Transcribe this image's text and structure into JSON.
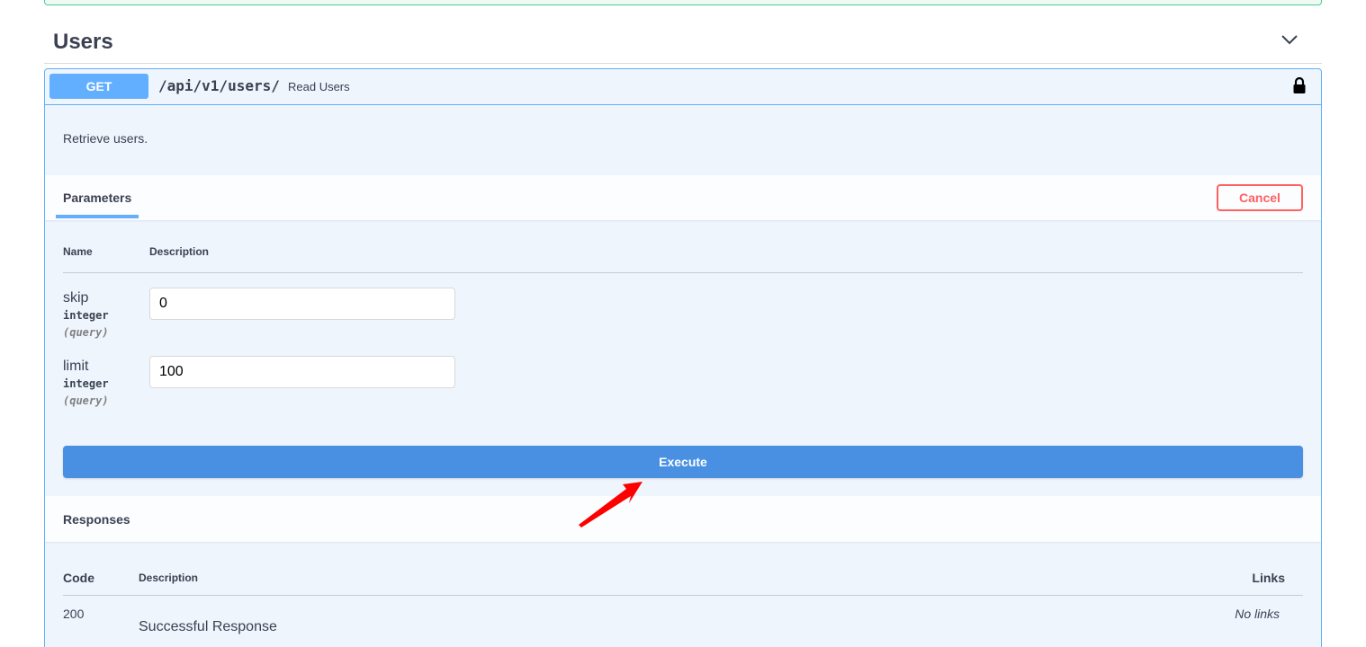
{
  "tag": {
    "title": "Users"
  },
  "operation": {
    "method": "GET",
    "path": "/api/v1/users/",
    "summary": "Read Users",
    "description": "Retrieve users."
  },
  "parameters": {
    "tab_label": "Parameters",
    "cancel_label": "Cancel",
    "col_name": "Name",
    "col_description": "Description",
    "items": [
      {
        "name": "skip",
        "type": "integer",
        "in": "(query)",
        "value": "0"
      },
      {
        "name": "limit",
        "type": "integer",
        "in": "(query)",
        "value": "100"
      }
    ]
  },
  "execute_label": "Execute",
  "responses": {
    "title": "Responses",
    "col_code": "Code",
    "col_description": "Description",
    "col_links": "Links",
    "items": [
      {
        "code": "200",
        "description": "Successful Response",
        "links": "No links"
      }
    ]
  },
  "colors": {
    "get_method": "#61affe",
    "execute": "#4990e2",
    "cancel": "#ff6060",
    "annotation_arrow": "#ff0000"
  },
  "icons": [
    "chevron-down-icon",
    "lock-icon",
    "annotation-arrow-icon"
  ]
}
